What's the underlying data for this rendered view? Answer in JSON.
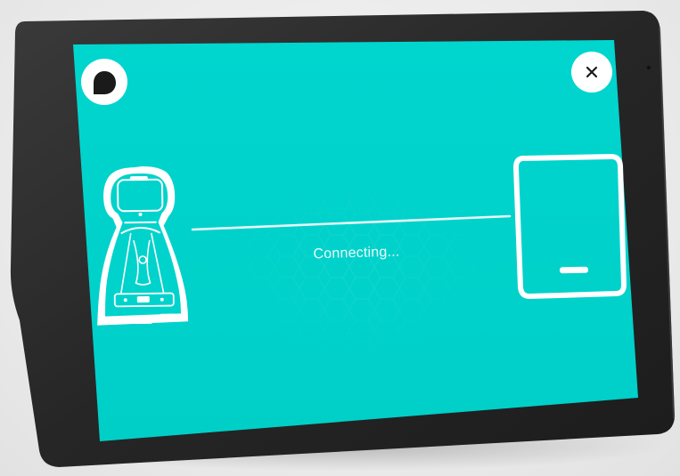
{
  "status": {
    "text": "Connecting..."
  },
  "colors": {
    "screen": "#00d3cc",
    "bezel": "#2a2a2a",
    "line": "#e6fbf9",
    "button_bg": "#ffffff",
    "icon_dark": "#1a1a1a"
  },
  "icons": {
    "logo": "app-logo-icon",
    "close": "close-icon",
    "robot": "robot-icon",
    "tablet": "tablet-icon"
  }
}
